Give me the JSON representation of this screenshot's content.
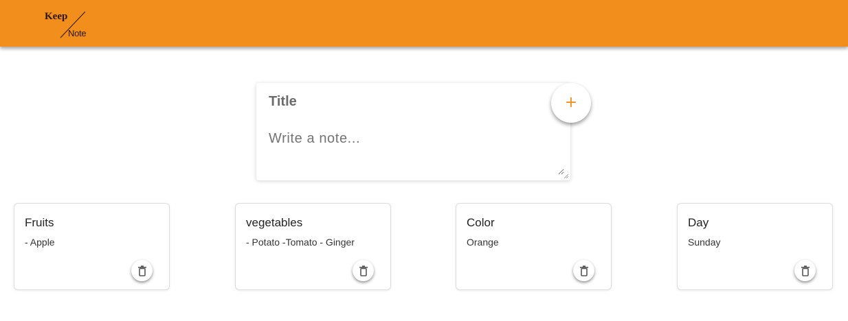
{
  "header": {
    "logo_top": "Keep",
    "logo_bottom": "Note",
    "background_color": "#f28f1c"
  },
  "composer": {
    "title_placeholder": "Title",
    "note_placeholder": "Write a note...",
    "title_value": "",
    "note_value": "",
    "add_button_icon": "plus-icon",
    "add_button_glyph": "+"
  },
  "notes": [
    {
      "title": "Fruits",
      "content": "- Apple",
      "delete_icon": "trash-icon"
    },
    {
      "title": "vegetables",
      "content": "- Potato -Tomato - Ginger",
      "delete_icon": "trash-icon"
    },
    {
      "title": "Color",
      "content": "Orange",
      "delete_icon": "trash-icon"
    },
    {
      "title": "Day",
      "content": "Sunday",
      "delete_icon": "trash-icon"
    }
  ]
}
